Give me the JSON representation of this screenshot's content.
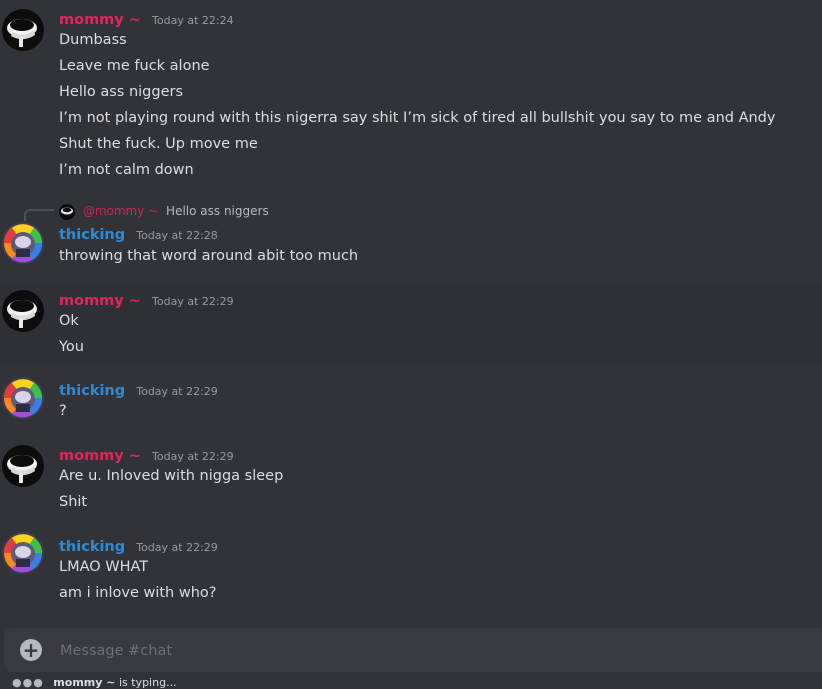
{
  "messages": [
    {
      "author": "mommy ~",
      "timestamp": "Today at 22:24",
      "lines": [
        "Dumbass",
        "Leave me fuck alone",
        "Hello ass niggers",
        "I’m not playing round with this nigerra say shit I’m sick of tired all bullshit you say to me and Andy",
        "Shut the fuck. Up move me",
        "I’m not calm down"
      ]
    },
    {
      "author": "thicking",
      "timestamp": "Today at 22:28",
      "reply_to": {
        "author": "@mommy ~",
        "text": "Hello ass niggers"
      },
      "lines": [
        "throwing that word around abit too much"
      ]
    },
    {
      "author": "mommy ~",
      "timestamp": "Today at 22:29",
      "lines": [
        "Ok",
        "You"
      ]
    },
    {
      "author": "thicking",
      "timestamp": "Today at 22:29",
      "lines": [
        "?"
      ]
    },
    {
      "author": "mommy ~",
      "timestamp": "Today at 22:29",
      "lines": [
        "Are u. Inloved with nigga sleep",
        "Shit"
      ]
    },
    {
      "author": "thicking",
      "timestamp": "Today at 22:29",
      "lines": [
        "LMAO WHAT",
        "am i inlove with who?"
      ]
    }
  ],
  "composer": {
    "placeholder": "Message #chat",
    "value": "",
    "attach_icon": "plus-circle-icon"
  },
  "typing": {
    "user": "mommy ~",
    "text": "is typing..."
  },
  "colors": {
    "background": "#313338",
    "mommy_name": "#e0275d",
    "thicking_name": "#2f8bd5",
    "message_text": "#dbdee1",
    "timestamp": "#949ba4",
    "composer_bg": "#383a40"
  }
}
